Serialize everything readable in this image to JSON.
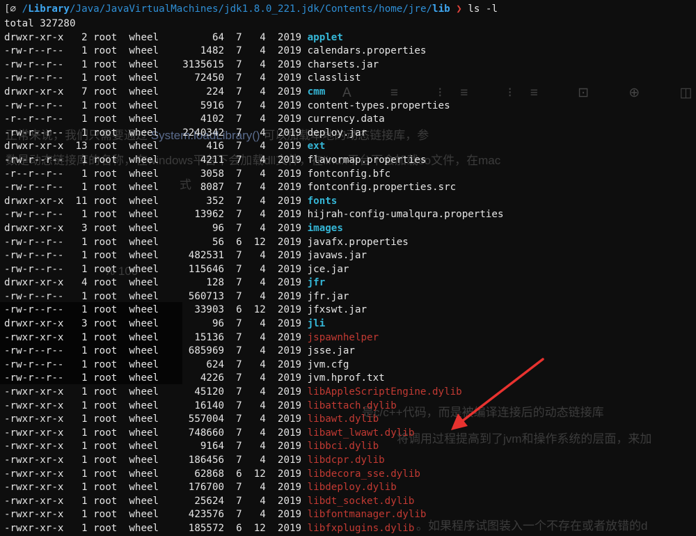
{
  "prompt": {
    "bracket": "[⌀",
    "path_pre": "/",
    "path_segments": [
      "Library",
      "/Java/JavaVirtualMachines/jdk1.8.0_221.jdk/Contents/home/jre/",
      "lib"
    ],
    "arrow": "❯",
    "command": "ls -l"
  },
  "total": "total 327280",
  "rows": [
    {
      "perm": "drwxr-xr-x",
      "links": "2",
      "owner": "root",
      "group": "wheel",
      "size": "64",
      "mon": "7",
      "day": "4",
      "year": "2019",
      "name": "applet",
      "kind": "dir"
    },
    {
      "perm": "-rw-r--r--",
      "links": "1",
      "owner": "root",
      "group": "wheel",
      "size": "1482",
      "mon": "7",
      "day": "4",
      "year": "2019",
      "name": "calendars.properties",
      "kind": "file"
    },
    {
      "perm": "-rw-r--r--",
      "links": "1",
      "owner": "root",
      "group": "wheel",
      "size": "3135615",
      "mon": "7",
      "day": "4",
      "year": "2019",
      "name": "charsets.jar",
      "kind": "file"
    },
    {
      "perm": "-rw-r--r--",
      "links": "1",
      "owner": "root",
      "group": "wheel",
      "size": "72450",
      "mon": "7",
      "day": "4",
      "year": "2019",
      "name": "classlist",
      "kind": "file"
    },
    {
      "perm": "drwxr-xr-x",
      "links": "7",
      "owner": "root",
      "group": "wheel",
      "size": "224",
      "mon": "7",
      "day": "4",
      "year": "2019",
      "name": "cmm",
      "kind": "dir"
    },
    {
      "perm": "-rw-r--r--",
      "links": "1",
      "owner": "root",
      "group": "wheel",
      "size": "5916",
      "mon": "7",
      "day": "4",
      "year": "2019",
      "name": "content-types.properties",
      "kind": "file"
    },
    {
      "perm": "-r--r--r--",
      "links": "1",
      "owner": "root",
      "group": "wheel",
      "size": "4102",
      "mon": "7",
      "day": "4",
      "year": "2019",
      "name": "currency.data",
      "kind": "file"
    },
    {
      "perm": "-rw-r--r--",
      "links": "1",
      "owner": "root",
      "group": "wheel",
      "size": "2240342",
      "mon": "7",
      "day": "4",
      "year": "2019",
      "name": "deploy.jar",
      "kind": "file"
    },
    {
      "perm": "drwxr-xr-x",
      "links": "13",
      "owner": "root",
      "group": "wheel",
      "size": "416",
      "mon": "7",
      "day": "4",
      "year": "2019",
      "name": "ext",
      "kind": "dir"
    },
    {
      "perm": "-rw-r--r--",
      "links": "1",
      "owner": "root",
      "group": "wheel",
      "size": "4211",
      "mon": "7",
      "day": "4",
      "year": "2019",
      "name": "flavormap.properties",
      "kind": "file"
    },
    {
      "perm": "-r--r--r--",
      "links": "1",
      "owner": "root",
      "group": "wheel",
      "size": "3058",
      "mon": "7",
      "day": "4",
      "year": "2019",
      "name": "fontconfig.bfc",
      "kind": "file"
    },
    {
      "perm": "-rw-r--r--",
      "links": "1",
      "owner": "root",
      "group": "wheel",
      "size": "8087",
      "mon": "7",
      "day": "4",
      "year": "2019",
      "name": "fontconfig.properties.src",
      "kind": "file"
    },
    {
      "perm": "drwxr-xr-x",
      "links": "11",
      "owner": "root",
      "group": "wheel",
      "size": "352",
      "mon": "7",
      "day": "4",
      "year": "2019",
      "name": "fonts",
      "kind": "dir"
    },
    {
      "perm": "-rw-r--r--",
      "links": "1",
      "owner": "root",
      "group": "wheel",
      "size": "13962",
      "mon": "7",
      "day": "4",
      "year": "2019",
      "name": "hijrah-config-umalqura.properties",
      "kind": "file"
    },
    {
      "perm": "drwxr-xr-x",
      "links": "3",
      "owner": "root",
      "group": "wheel",
      "size": "96",
      "mon": "7",
      "day": "4",
      "year": "2019",
      "name": "images",
      "kind": "dir"
    },
    {
      "perm": "-rw-r--r--",
      "links": "1",
      "owner": "root",
      "group": "wheel",
      "size": "56",
      "mon": "6",
      "day": "12",
      "year": "2019",
      "name": "javafx.properties",
      "kind": "file"
    },
    {
      "perm": "-rw-r--r--",
      "links": "1",
      "owner": "root",
      "group": "wheel",
      "size": "482531",
      "mon": "7",
      "day": "4",
      "year": "2019",
      "name": "javaws.jar",
      "kind": "file"
    },
    {
      "perm": "-rw-r--r--",
      "links": "1",
      "owner": "root",
      "group": "wheel",
      "size": "115646",
      "mon": "7",
      "day": "4",
      "year": "2019",
      "name": "jce.jar",
      "kind": "file"
    },
    {
      "perm": "drwxr-xr-x",
      "links": "4",
      "owner": "root",
      "group": "wheel",
      "size": "128",
      "mon": "7",
      "day": "4",
      "year": "2019",
      "name": "jfr",
      "kind": "dir"
    },
    {
      "perm": "-rw-r--r--",
      "links": "1",
      "owner": "root",
      "group": "wheel",
      "size": "560713",
      "mon": "7",
      "day": "4",
      "year": "2019",
      "name": "jfr.jar",
      "kind": "file"
    },
    {
      "perm": "-rw-r--r--",
      "links": "1",
      "owner": "root",
      "group": "wheel",
      "size": "33903",
      "mon": "6",
      "day": "12",
      "year": "2019",
      "name": "jfxswt.jar",
      "kind": "file"
    },
    {
      "perm": "drwxr-xr-x",
      "links": "3",
      "owner": "root",
      "group": "wheel",
      "size": "96",
      "mon": "7",
      "day": "4",
      "year": "2019",
      "name": "jli",
      "kind": "dir"
    },
    {
      "perm": "-rwxr-xr-x",
      "links": "1",
      "owner": "root",
      "group": "wheel",
      "size": "15136",
      "mon": "7",
      "day": "4",
      "year": "2019",
      "name": "jspawnhelper",
      "kind": "exe"
    },
    {
      "perm": "-rw-r--r--",
      "links": "1",
      "owner": "root",
      "group": "wheel",
      "size": "685969",
      "mon": "7",
      "day": "4",
      "year": "2019",
      "name": "jsse.jar",
      "kind": "file"
    },
    {
      "perm": "-rw-r--r--",
      "links": "1",
      "owner": "root",
      "group": "wheel",
      "size": "624",
      "mon": "7",
      "day": "4",
      "year": "2019",
      "name": "jvm.cfg",
      "kind": "file"
    },
    {
      "perm": "-rw-r--r--",
      "links": "1",
      "owner": "root",
      "group": "wheel",
      "size": "4226",
      "mon": "7",
      "day": "4",
      "year": "2019",
      "name": "jvm.hprof.txt",
      "kind": "file"
    },
    {
      "perm": "-rwxr-xr-x",
      "links": "1",
      "owner": "root",
      "group": "wheel",
      "size": "45120",
      "mon": "7",
      "day": "4",
      "year": "2019",
      "name": "libAppleScriptEngine.dylib",
      "kind": "exe"
    },
    {
      "perm": "-rwxr-xr-x",
      "links": "1",
      "owner": "root",
      "group": "wheel",
      "size": "16140",
      "mon": "7",
      "day": "4",
      "year": "2019",
      "name": "libattach.dylib",
      "kind": "exe"
    },
    {
      "perm": "-rwxr-xr-x",
      "links": "1",
      "owner": "root",
      "group": "wheel",
      "size": "557004",
      "mon": "7",
      "day": "4",
      "year": "2019",
      "name": "libawt.dylib",
      "kind": "exe"
    },
    {
      "perm": "-rwxr-xr-x",
      "links": "1",
      "owner": "root",
      "group": "wheel",
      "size": "748660",
      "mon": "7",
      "day": "4",
      "year": "2019",
      "name": "libawt_lwawt.dylib",
      "kind": "exe"
    },
    {
      "perm": "-rwxr-xr-x",
      "links": "1",
      "owner": "root",
      "group": "wheel",
      "size": "9164",
      "mon": "7",
      "day": "4",
      "year": "2019",
      "name": "libbci.dylib",
      "kind": "exe"
    },
    {
      "perm": "-rwxr-xr-x",
      "links": "1",
      "owner": "root",
      "group": "wheel",
      "size": "186456",
      "mon": "7",
      "day": "4",
      "year": "2019",
      "name": "libdcpr.dylib",
      "kind": "exe"
    },
    {
      "perm": "-rwxr-xr-x",
      "links": "1",
      "owner": "root",
      "group": "wheel",
      "size": "62868",
      "mon": "6",
      "day": "12",
      "year": "2019",
      "name": "libdecora_sse.dylib",
      "kind": "exe"
    },
    {
      "perm": "-rwxr-xr-x",
      "links": "1",
      "owner": "root",
      "group": "wheel",
      "size": "176700",
      "mon": "7",
      "day": "4",
      "year": "2019",
      "name": "libdeploy.dylib",
      "kind": "exe"
    },
    {
      "perm": "-rwxr-xr-x",
      "links": "1",
      "owner": "root",
      "group": "wheel",
      "size": "25624",
      "mon": "7",
      "day": "4",
      "year": "2019",
      "name": "libdt_socket.dylib",
      "kind": "exe"
    },
    {
      "perm": "-rwxr-xr-x",
      "links": "1",
      "owner": "root",
      "group": "wheel",
      "size": "423576",
      "mon": "7",
      "day": "4",
      "year": "2019",
      "name": "libfontmanager.dylib",
      "kind": "exe"
    },
    {
      "perm": "-rwxr-xr-x",
      "links": "1",
      "owner": "root",
      "group": "wheel",
      "size": "185572",
      "mon": "6",
      "day": "12",
      "year": "2019",
      "name": "libfxplugins.dylib",
      "kind": "exe"
    }
  ],
  "background_doc": {
    "lines": [
      {
        "text_a": "正常来说，我们只需要通过 ",
        "code": "System.loadLibrary()",
        "text_b": " 可以加载本地的动态链接库，参"
      },
      {
        "text_a": "数是动态链接库的名称，在windows平台下会加载dll文件，在linux平台下会加载so文件，在mac",
        "code": "",
        "text_b": ""
      },
      {
        "text_a": "是c/c++代码，而是被编译连接后的动态链接库",
        "code": "",
        "text_b": ""
      },
      {
        "text_a": "将调用过程提高到了jvm和操作系统的层面，来加",
        "code": "",
        "text_b": ""
      },
      {
        "text_a": "。如果程序试图装入一个不存在或者放错的d",
        "code": "",
        "text_b": ""
      }
    ],
    "toolbar_glyphs": "A ≡ ⁝≡ ⁝≡ ⊡ ⊕ ◫",
    "percent": "%  100",
    "image_label": "式"
  },
  "colors": {
    "background": "#0e0e0e",
    "dir": "#35b6d6",
    "exe": "#c33a33",
    "prompt_path": "#2f8fd6",
    "prompt_arrow": "#e0433c",
    "annotation_arrow": "#e8322f"
  }
}
